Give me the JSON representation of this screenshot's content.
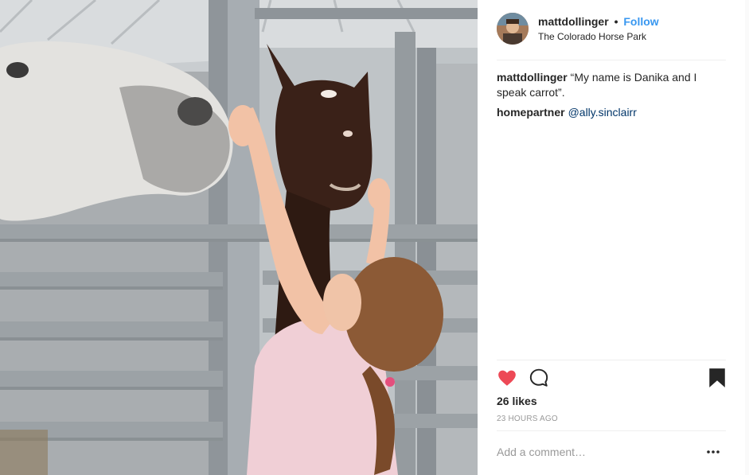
{
  "post": {
    "username": "mattdollinger",
    "separator": "•",
    "follow_label": "Follow",
    "location": "The Colorado Horse Park",
    "comments": [
      {
        "author": "mattdollinger",
        "text": "“My name is Danika and I speak carrot”."
      },
      {
        "author": "homepartner",
        "text": "@ally.sinclairr"
      }
    ],
    "likes": "26 likes",
    "timestamp": "23 HOURS AGO",
    "add_comment_placeholder": "Add a comment…",
    "like_color": "#ed4956",
    "follow_color": "#3897f0"
  }
}
